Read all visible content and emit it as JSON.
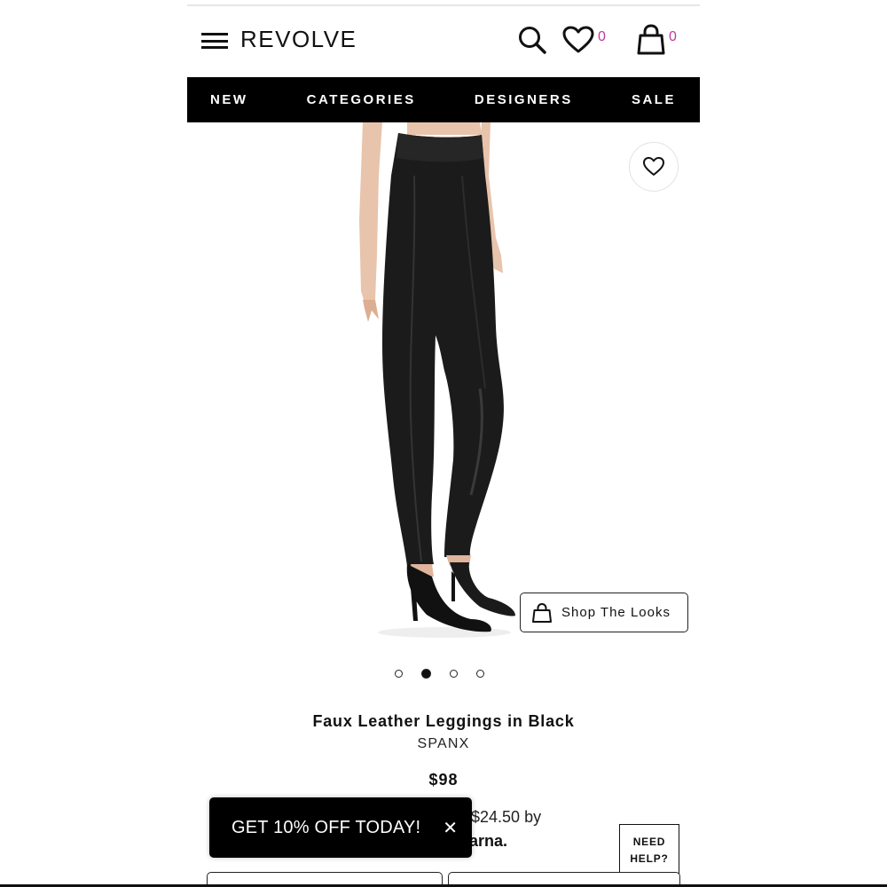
{
  "header": {
    "logo": "REVOLVE",
    "wishlist_count": "0",
    "cart_count": "0"
  },
  "nav": {
    "items": [
      {
        "label": "NEW"
      },
      {
        "label": "CATEGORIES"
      },
      {
        "label": "DESIGNERS"
      },
      {
        "label": "SALE"
      }
    ]
  },
  "product": {
    "shop_looks_label": "Shop The Looks",
    "carousel": {
      "count": 4,
      "active_index": 1
    },
    "title": "Faux Leather Leggings in Black",
    "brand": "SPANX",
    "price": "$98",
    "installments_text": "of $24.50 by",
    "klarna_label": "Klarna."
  },
  "promo": {
    "text": "GET 10% OFF TODAY!",
    "close_icon": "close-icon"
  },
  "help": {
    "line1": "NEED",
    "line2": "HELP?"
  },
  "colors": {
    "accent_badge": "#c0399c",
    "nav_bg": "#000000"
  }
}
